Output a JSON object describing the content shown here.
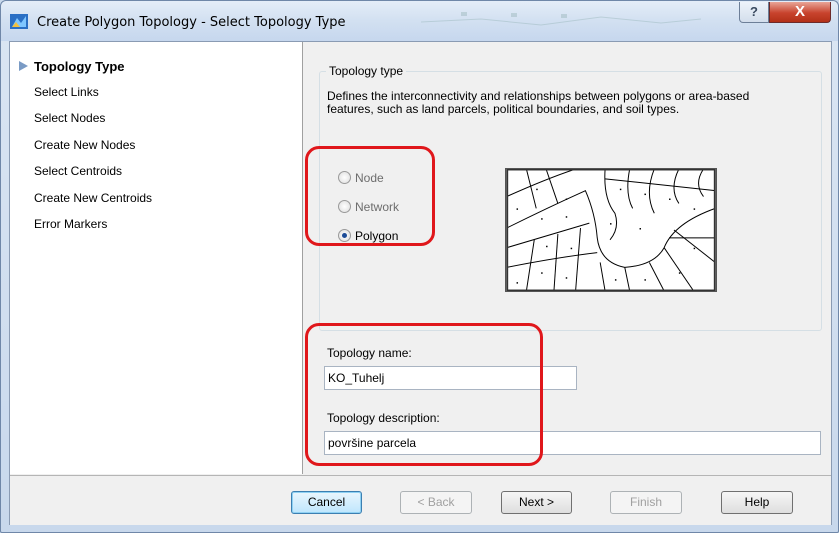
{
  "window": {
    "title": "Create Polygon Topology - Select Topology Type",
    "help_button": "?",
    "close_button": "X"
  },
  "nav": {
    "items": [
      {
        "label": "Topology Type",
        "active": true
      },
      {
        "label": "Select Links",
        "active": false
      },
      {
        "label": "Select Nodes",
        "active": false
      },
      {
        "label": "Create New Nodes",
        "active": false
      },
      {
        "label": "Select Centroids",
        "active": false
      },
      {
        "label": "Create New Centroids",
        "active": false
      },
      {
        "label": "Error Markers",
        "active": false
      }
    ]
  },
  "topology_type": {
    "group_label": "Topology type",
    "description": "Defines the interconnectivity and relationships between polygons or area-based features, such as land parcels, political boundaries, and soil types.",
    "options": [
      {
        "label": "Node",
        "selected": false
      },
      {
        "label": "Network",
        "selected": false
      },
      {
        "label": "Polygon",
        "selected": true
      }
    ]
  },
  "form": {
    "name_label": "Topology name:",
    "name_value": "KO_Tuhelj",
    "description_label": "Topology description:",
    "description_value": "površine parcela"
  },
  "buttons": {
    "cancel": "Cancel",
    "back": "< Back",
    "next": "Next >",
    "finish": "Finish",
    "help": "Help"
  },
  "colors": {
    "highlight": "#e0171b",
    "nav_arrow": "#7a9bc5",
    "close": "#c8432d"
  }
}
